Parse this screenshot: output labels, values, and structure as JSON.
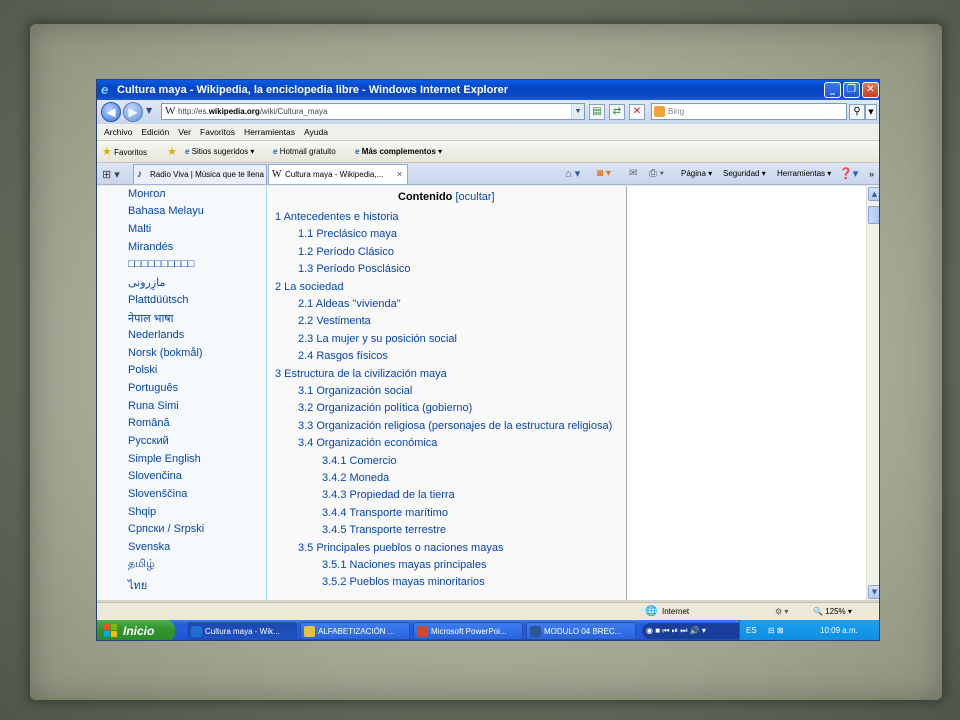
{
  "window": {
    "title": "Cultura maya - Wikipedia, la enciclopedia libre - Windows Internet Explorer",
    "minimize": "_",
    "maximize": "❐",
    "close": "✕"
  },
  "address": {
    "url_prefix": "http://es.",
    "url_domain": "wikipedia.org",
    "url_path": "/wiki/Cultura_maya",
    "search_placeholder": "Bing"
  },
  "menu": [
    "Archivo",
    "Edición",
    "Ver",
    "Favoritos",
    "Herramientas",
    "Ayuda"
  ],
  "favorites_bar": {
    "favorites": "Favoritos",
    "suggested": "Sitios sugeridos",
    "hotmail": "Hotmail gratuito",
    "more": "Más complementos"
  },
  "tabs": [
    {
      "label": "Radio Viva | Música que te llena",
      "active": false
    },
    {
      "label": "Cultura maya - Wikipedia,...",
      "active": true
    }
  ],
  "commands": {
    "page": "Página",
    "security": "Seguridad",
    "tools": "Herramientas"
  },
  "sidebar": {
    "languages": [
      "Монгол",
      "Bahasa Melayu",
      "Malti",
      "Mirandés",
      "□□□□□□□□□□",
      "مازِرونی",
      "Plattdüütsch",
      "नेपाल भाषा",
      "Nederlands",
      "Norsk (bokmål)",
      "Polski",
      "Português",
      "Runa Simi",
      "Română",
      "Русский",
      "Simple English",
      "Slovenčina",
      "Slovenščina",
      "Shqip",
      "Српски / Srpski",
      "Svenska",
      "தமிழ்",
      "ไทย"
    ]
  },
  "toc": {
    "title": "Contenido",
    "toggle": "[ocultar]",
    "entries": [
      {
        "text": "1 Antecedentes e historia",
        "level": 1
      },
      {
        "text": "1.1 Preclásico maya",
        "level": 2
      },
      {
        "text": "1.2 Período Clásico",
        "level": 2
      },
      {
        "text": "1.3 Período Posclásico",
        "level": 2
      },
      {
        "text": "2 La sociedad",
        "level": 1
      },
      {
        "text": "2.1 Aldeas \"vivienda\"",
        "level": 2
      },
      {
        "text": "2.2 Vestimenta",
        "level": 2
      },
      {
        "text": "2.3 La mujer y su posición social",
        "level": 2
      },
      {
        "text": "2.4 Rasgos físicos",
        "level": 2
      },
      {
        "text": "3 Estructura de la civilización maya",
        "level": 1
      },
      {
        "text": "3.1 Organización social",
        "level": 2
      },
      {
        "text": "3.2 Organización política (gobierno)",
        "level": 2
      },
      {
        "text": "3.3 Organización religiosa (personajes de la estructura religiosa)",
        "level": 2
      },
      {
        "text": "3.4 Organización económica",
        "level": 2
      },
      {
        "text": "3.4.1 Comercio",
        "level": 3
      },
      {
        "text": "3.4.2 Moneda",
        "level": 3
      },
      {
        "text": "3.4.3 Propiedad de la tierra",
        "level": 3
      },
      {
        "text": "3.4.4 Transporte marítimo",
        "level": 3
      },
      {
        "text": "3.4.5 Transporte terrestre",
        "level": 3
      },
      {
        "text": "3.5 Principales pueblos o naciones mayas",
        "level": 2
      },
      {
        "text": "3.5.1 Naciones mayas principales",
        "level": 3
      },
      {
        "text": "3.5.2 Pueblos mayas minoritarios",
        "level": 3
      }
    ]
  },
  "status": {
    "zone": "Internet",
    "zoom": "125%"
  },
  "taskbar": {
    "start": "Inicio",
    "items": [
      {
        "label": "Cultura maya - Wik...",
        "active": true
      },
      {
        "label": "ALFABETIZACIÓN ...",
        "active": false
      },
      {
        "label": "Microsoft PowerPoi...",
        "active": false
      },
      {
        "label": "MODULO 04 BREC...",
        "active": false
      }
    ],
    "lang": "ES",
    "clock": "10:09 a.m."
  }
}
